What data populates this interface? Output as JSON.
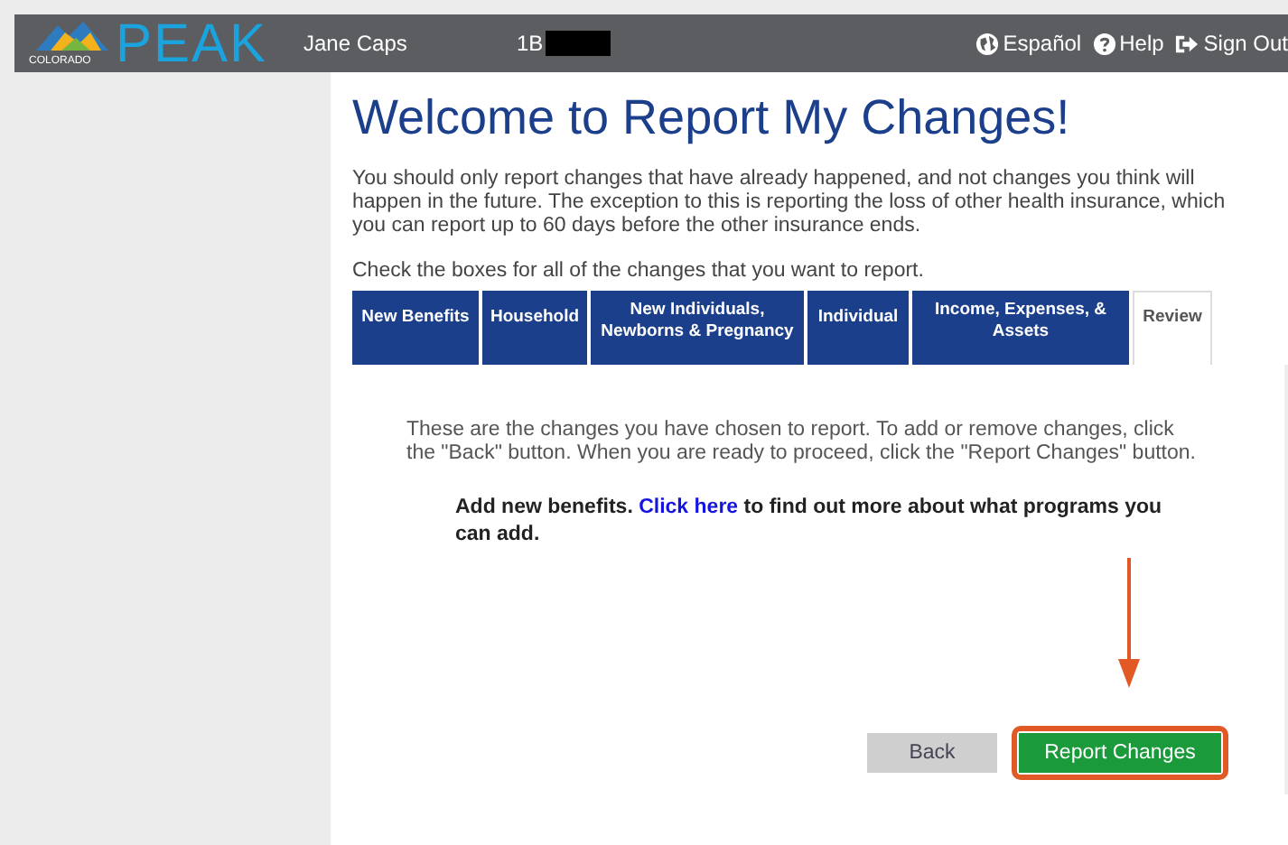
{
  "header": {
    "logo_small": "COLORADO",
    "logo": "PEAK",
    "user_name": "Jane Caps",
    "case_id": "1B",
    "links": [
      {
        "kind": "globe",
        "label": "Español"
      },
      {
        "kind": "help",
        "label": "Help"
      },
      {
        "kind": "signout",
        "label": "Sign Out"
      }
    ]
  },
  "title": "Welcome to Report My Changes!",
  "intro": "You should only report changes that have already happened, and not changes you think will happen in the future. The exception to this is reporting the loss of other health insurance, which you can report up to 60 days before the other insurance ends.",
  "instruction": "Check the boxes for all of the changes that you want to report.",
  "tabs": [
    {
      "label": "New Benefits",
      "selected": false
    },
    {
      "label": "Household",
      "selected": false
    },
    {
      "label": "New Individuals, Newborns & Pregnancy",
      "selected": false
    },
    {
      "label": "Individual",
      "selected": false
    },
    {
      "label": "Income, Expenses, & Assets",
      "selected": false
    },
    {
      "label": "Review",
      "selected": true
    }
  ],
  "review": {
    "text": "These are the changes you have chosen to report. To add or remove changes, click the \"Back\" button. When you are ready to proceed, click the \"Report Changes\" button.",
    "benefits_before": "Add new benefits.",
    "benefits_link": "Click here",
    "benefits_after": "to find out more about what programs you can add."
  },
  "buttons": [
    {
      "kind": "secondary",
      "label": "Back",
      "highlighted": false
    },
    {
      "kind": "primary",
      "label": "Report Changes",
      "highlighted": true
    }
  ]
}
